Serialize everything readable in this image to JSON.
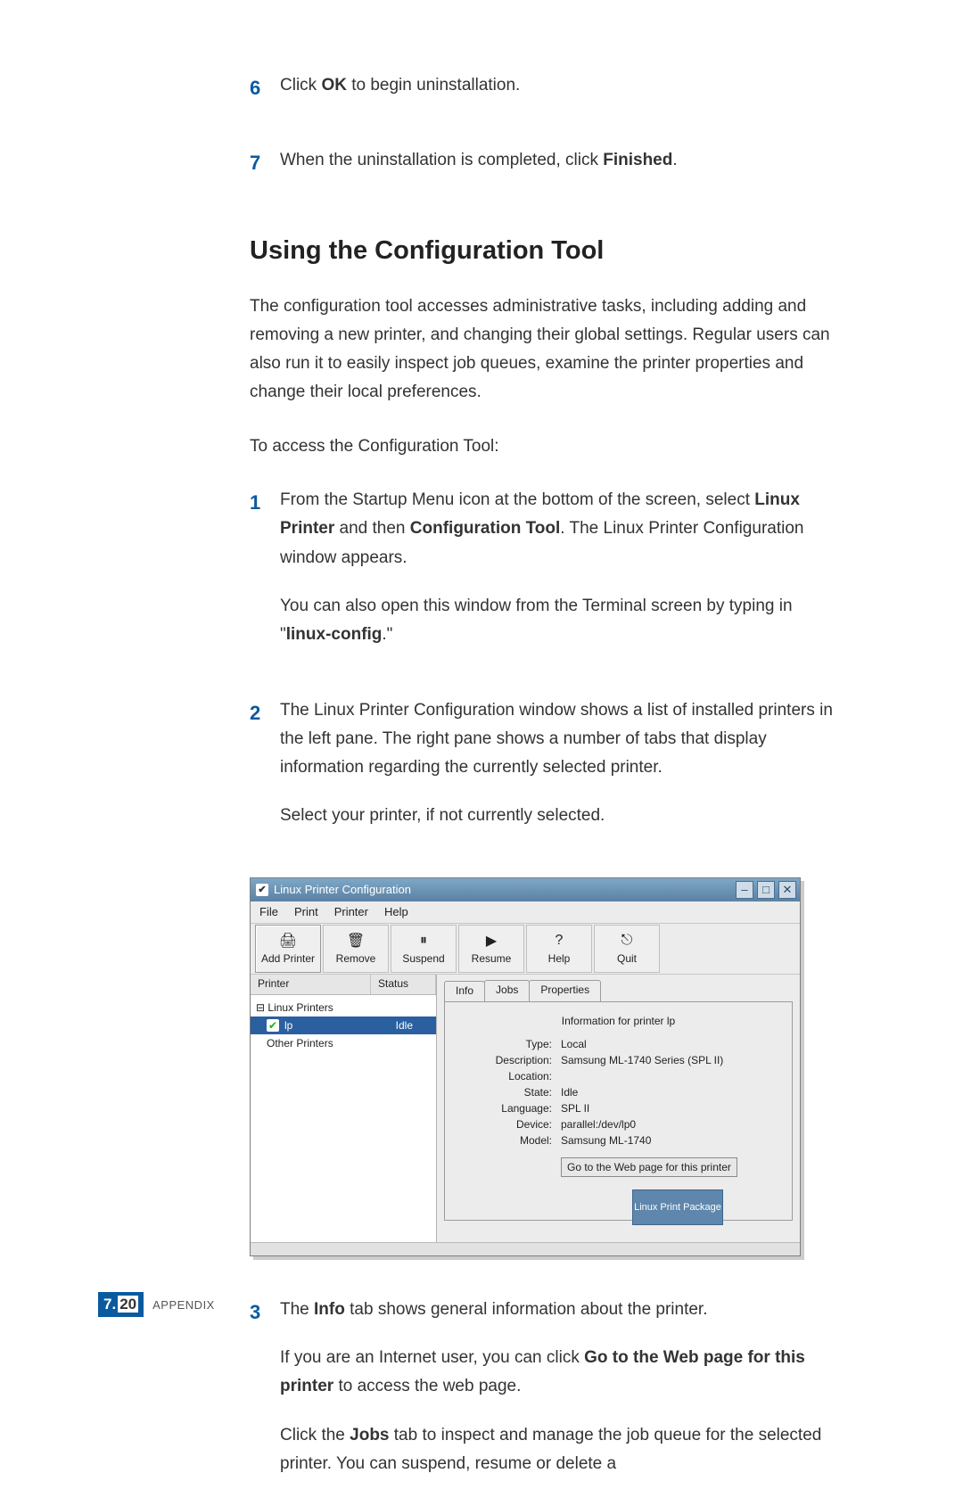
{
  "steps_top": [
    {
      "num": "6",
      "html": "Click <b>OK</b> to begin uninstallation."
    },
    {
      "num": "7",
      "html": "When the uninstallation is completed, click <b>Finished</b>."
    }
  ],
  "section_title": "Using the Configuration Tool",
  "intro": "The configuration tool accesses administrative tasks, including adding and removing a new printer, and changing their global settings. Regular users can also run it to easily inspect job queues, examine the printer properties and change their local preferences.",
  "to_access": "To access the Configuration Tool:",
  "steps_num": [
    {
      "num": "1",
      "paras": [
        "From the Startup Menu icon at the bottom of the screen, select <b>Linux Printer</b> and then <b>Configuration Tool</b>. The Linux Printer Configuration window appears.",
        "You can also open this window from the Terminal screen by typing in \"<b>linux-config</b>.\""
      ]
    },
    {
      "num": "2",
      "paras": [
        "The Linux Printer Configuration window shows a list of installed printers in the left pane. The right pane shows a number of tabs that display information regarding the currently selected printer.",
        "Select your printer, if not currently selected."
      ]
    }
  ],
  "steps_after": [
    {
      "num": "3",
      "paras": [
        "The <b>Info</b> tab shows general information about the printer.",
        "If you are an Internet user, you can click <b>Go to the Web page for this printer</b> to access the web page.",
        "Click the <b>Jobs</b> tab to inspect and manage the job queue for the selected printer. You can suspend, resume or delete a"
      ]
    }
  ],
  "window": {
    "title": "Linux Printer Configuration",
    "menu": [
      "File",
      "Print",
      "Printer",
      "Help"
    ],
    "toolbar": [
      {
        "label": "Add Printer",
        "glyph": "🖨"
      },
      {
        "label": "Remove",
        "glyph": "🗑"
      },
      {
        "label": "Suspend",
        "glyph": "⏸"
      },
      {
        "label": "Resume",
        "glyph": "▶"
      },
      {
        "label": "Help",
        "glyph": "?"
      },
      {
        "label": "Quit",
        "glyph": "⎋"
      }
    ],
    "tree": {
      "headers": [
        "Printer",
        "Status"
      ],
      "root": "Linux Printers",
      "selected": {
        "name": "lp",
        "status": "Idle"
      },
      "other": "Other Printers"
    },
    "tabs": [
      "Info",
      "Jobs",
      "Properties"
    ],
    "info": {
      "heading": "Information for printer lp",
      "Type": "Local",
      "Description": "Samsung ML-1740 Series (SPL II)",
      "Location": "",
      "State": "Idle",
      "Language": "SPL II",
      "Device": "parallel:/dev/lp0",
      "Model": "Samsung ML-1740",
      "web_button": "Go to the Web page for this printer",
      "badge": "Linux Print Package"
    },
    "controls": {
      "min": "–",
      "max": "□",
      "close": "✕"
    }
  },
  "footer": {
    "chapter": "7.",
    "page": "20",
    "label": "APPENDIX"
  }
}
